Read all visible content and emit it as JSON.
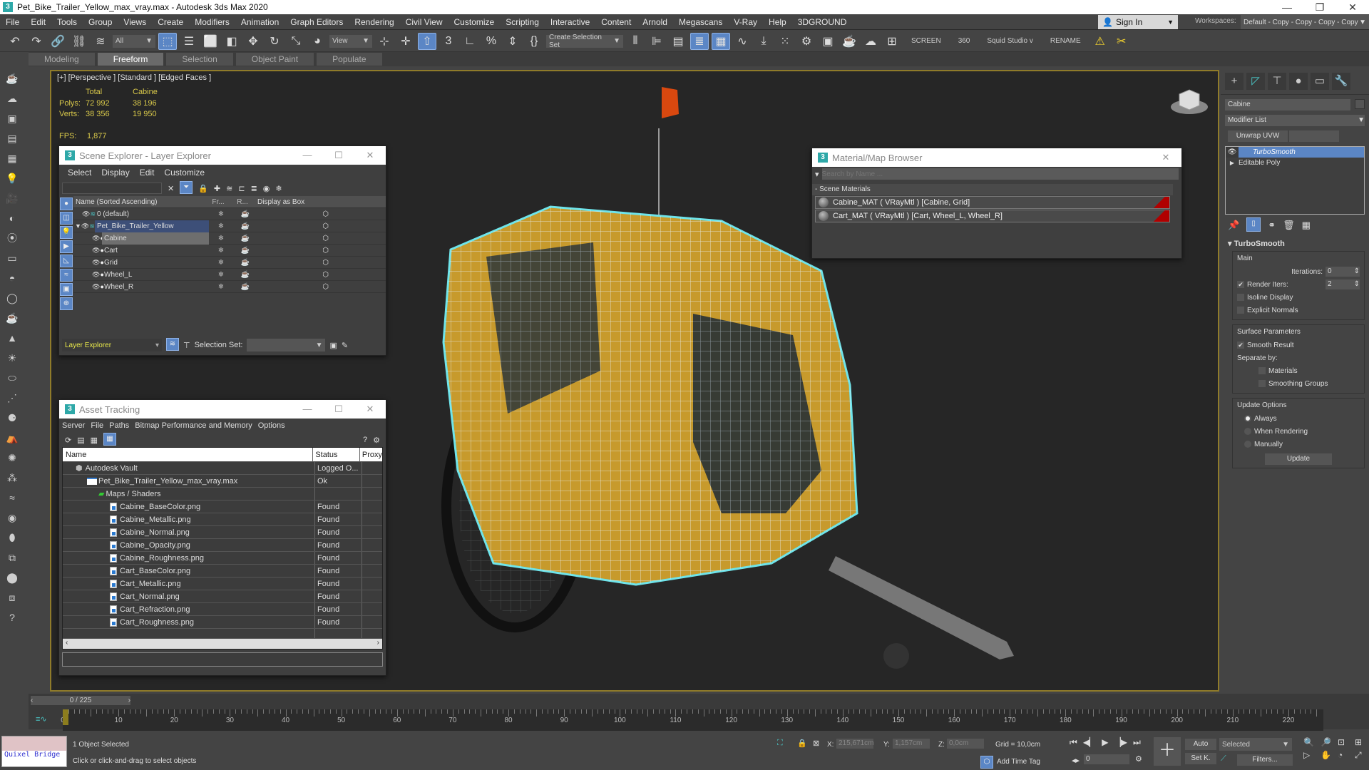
{
  "window": {
    "title": "Pet_Bike_Trailer_Yellow_max_vray.max - Autodesk 3ds Max 2020",
    "app_icon": "3",
    "controls": [
      "minimize",
      "restore",
      "close"
    ]
  },
  "menubar": [
    "File",
    "Edit",
    "Tools",
    "Group",
    "Views",
    "Create",
    "Modifiers",
    "Animation",
    "Graph Editors",
    "Rendering",
    "Civil View",
    "Customize",
    "Scripting",
    "Interactive",
    "Content",
    "Arnold",
    "Megascans",
    "V-Ray",
    "Help",
    "3DGROUND"
  ],
  "account": {
    "sign_in": "Sign In",
    "workspaces_label": "Workspaces:",
    "workspace_value": "Default - Copy - Copy - Copy - Copy"
  },
  "toolbar": {
    "filter": "All",
    "coord_system": "View",
    "selection_set": "Create Selection Set",
    "text_items": [
      "SCREEN",
      "360",
      "Squid Studio v",
      "RENAME"
    ]
  },
  "ribbon": {
    "tabs": [
      "Modeling",
      "Freeform",
      "Selection",
      "Object Paint",
      "Populate"
    ],
    "active": "Freeform"
  },
  "viewport": {
    "label": "[+] [Perspective ] [Standard ] [Edged Faces ]",
    "stats": {
      "col_total": "Total",
      "col_sel": "Cabine",
      "polys_label": "Polys:",
      "polys_total": "72 992",
      "polys_sel": "38 196",
      "verts_label": "Verts:",
      "verts_total": "38 356",
      "verts_sel": "19 950",
      "fps_label": "FPS:",
      "fps": "1,877"
    }
  },
  "scene_explorer": {
    "title": "Scene Explorer - Layer Explorer",
    "menu": [
      "Select",
      "Display",
      "Edit",
      "Customize"
    ],
    "columns": [
      "Name (Sorted Ascending)",
      "Fr...",
      "R...",
      "Display as Box"
    ],
    "rows": [
      {
        "name": "0 (default)",
        "level": 0,
        "type": "layer"
      },
      {
        "name": "Pet_Bike_Trailer_Yellow",
        "level": 0,
        "type": "layer",
        "expanded": true
      },
      {
        "name": "Cabine",
        "level": 1,
        "type": "object",
        "selected": true
      },
      {
        "name": "Cart",
        "level": 1,
        "type": "object"
      },
      {
        "name": "Grid",
        "level": 1,
        "type": "object"
      },
      {
        "name": "Wheel_L",
        "level": 1,
        "type": "object"
      },
      {
        "name": "Wheel_R",
        "level": 1,
        "type": "object"
      }
    ],
    "footer": {
      "explorer": "Layer Explorer",
      "selection_set_label": "Selection Set:"
    }
  },
  "asset_tracking": {
    "title": "Asset Tracking",
    "menu": [
      "Server",
      "File",
      "Paths",
      "Bitmap Performance and Memory",
      "Options"
    ],
    "columns": [
      "Name",
      "Status",
      "Proxy"
    ],
    "rows": [
      {
        "name": "Autodesk Vault",
        "status": "Logged O...",
        "level": 0,
        "icon": "vault-icon"
      },
      {
        "name": "Pet_Bike_Trailer_Yellow_max_vray.max",
        "status": "Ok",
        "level": 1,
        "icon": "max-file-icon"
      },
      {
        "name": "Maps / Shaders",
        "status": "",
        "level": 2,
        "icon": "maps-icon"
      },
      {
        "name": "Cabine_BaseColor.png",
        "status": "Found",
        "level": 3,
        "icon": "image-file-icon"
      },
      {
        "name": "Cabine_Metallic.png",
        "status": "Found",
        "level": 3,
        "icon": "image-file-icon"
      },
      {
        "name": "Cabine_Normal.png",
        "status": "Found",
        "level": 3,
        "icon": "image-file-icon"
      },
      {
        "name": "Cabine_Opacity.png",
        "status": "Found",
        "level": 3,
        "icon": "image-file-icon"
      },
      {
        "name": "Cabine_Roughness.png",
        "status": "Found",
        "level": 3,
        "icon": "image-file-icon"
      },
      {
        "name": "Cart_BaseColor.png",
        "status": "Found",
        "level": 3,
        "icon": "image-file-icon"
      },
      {
        "name": "Cart_Metallic.png",
        "status": "Found",
        "level": 3,
        "icon": "image-file-icon"
      },
      {
        "name": "Cart_Normal.png",
        "status": "Found",
        "level": 3,
        "icon": "image-file-icon"
      },
      {
        "name": "Cart_Refraction.png",
        "status": "Found",
        "level": 3,
        "icon": "image-file-icon"
      },
      {
        "name": "Cart_Roughness.png",
        "status": "Found",
        "level": 3,
        "icon": "image-file-icon"
      }
    ]
  },
  "material_browser": {
    "title": "Material/Map Browser",
    "search_placeholder": "Search by Name ...",
    "section": "- Scene Materials",
    "materials": [
      "Cabine_MAT  ( VRayMtl )  [Cabine, Grid]",
      "Cart_MAT  ( VRayMtl )  [Cart, Wheel_L, Wheel_R]"
    ]
  },
  "command_panel": {
    "object_name": "Cabine",
    "modifier_list": "Modifier List",
    "unwrap_button": "Unwrap UVW",
    "stack": [
      "TurboSmooth",
      "Editable Poly"
    ],
    "turbosmooth": {
      "title": "TurboSmooth",
      "main_label": "Main",
      "iterations_label": "Iterations:",
      "iterations": "0",
      "render_iters_label": "Render Iters:",
      "render_iters": "2",
      "render_iters_checked": true,
      "isoline_label": "Isoline Display",
      "isoline_checked": false,
      "explicit_label": "Explicit Normals",
      "explicit_checked": false,
      "surface_label": "Surface Parameters",
      "smooth_result_label": "Smooth Result",
      "smooth_result_checked": true,
      "separate_label": "Separate by:",
      "materials_label": "Materials",
      "smoothing_groups_label": "Smoothing Groups",
      "update_label": "Update Options",
      "update_options": [
        "Always",
        "When Rendering",
        "Manually"
      ],
      "update_selected": "Always",
      "update_button": "Update"
    }
  },
  "timeline": {
    "frame_display": "0 / 225",
    "current_frame": 0,
    "total_frames": 225,
    "ticks": [
      0,
      10,
      20,
      30,
      40,
      50,
      60,
      70,
      80,
      90,
      100,
      110,
      120,
      130,
      140,
      150,
      160,
      170,
      180,
      190,
      200,
      210,
      220
    ]
  },
  "status": {
    "quixel": "Quixel Bridge",
    "selected": "1 Object Selected",
    "prompt": "Click or click-and-drag to select objects",
    "x_label": "X:",
    "x": "215,671cm",
    "y_label": "Y:",
    "y": "1,157cm",
    "z_label": "Z:",
    "z": "0,0cm",
    "grid": "Grid = 10,0cm",
    "add_time_tag": "Add Time Tag",
    "frame_field": "0",
    "auto": "Auto",
    "set_key": "Set K.",
    "key_filter": "Selected",
    "filters": "Filters..."
  }
}
